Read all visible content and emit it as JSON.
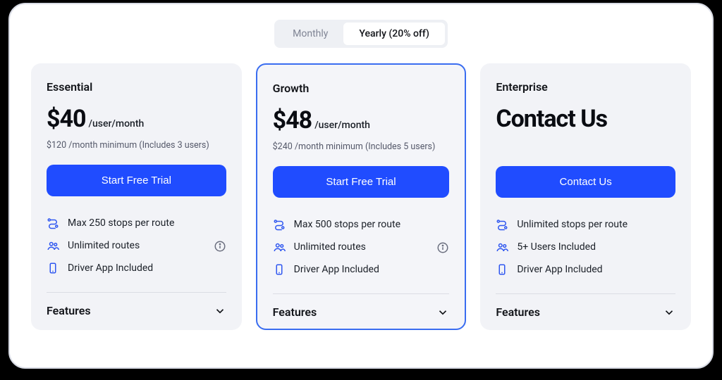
{
  "billingToggle": {
    "monthly": "Monthly",
    "yearly": "Yearly (20% off)"
  },
  "plans": {
    "essential": {
      "name": "Essential",
      "price": "$40",
      "unit": "/user/month",
      "minimum": "$120 /month minimum (Includes 3 users)",
      "cta": "Start Free Trial",
      "features": {
        "f1": "Max 250 stops per route",
        "f2": "Unlimited routes",
        "f3": "Driver App Included"
      }
    },
    "growth": {
      "name": "Growth",
      "price": "$48",
      "unit": "/user/month",
      "minimum": "$240 /month minimum (Includes 5 users)",
      "cta": "Start Free Trial",
      "features": {
        "f1": "Max 500 stops per route",
        "f2": "Unlimited routes",
        "f3": "Driver App Included"
      }
    },
    "enterprise": {
      "name": "Enterprise",
      "price": "Contact Us",
      "cta": "Contact Us",
      "features": {
        "f1": "Unlimited stops per route",
        "f2": "5+ Users Included",
        "f3": "Driver App Included"
      }
    }
  },
  "featuresLabel": "Features"
}
